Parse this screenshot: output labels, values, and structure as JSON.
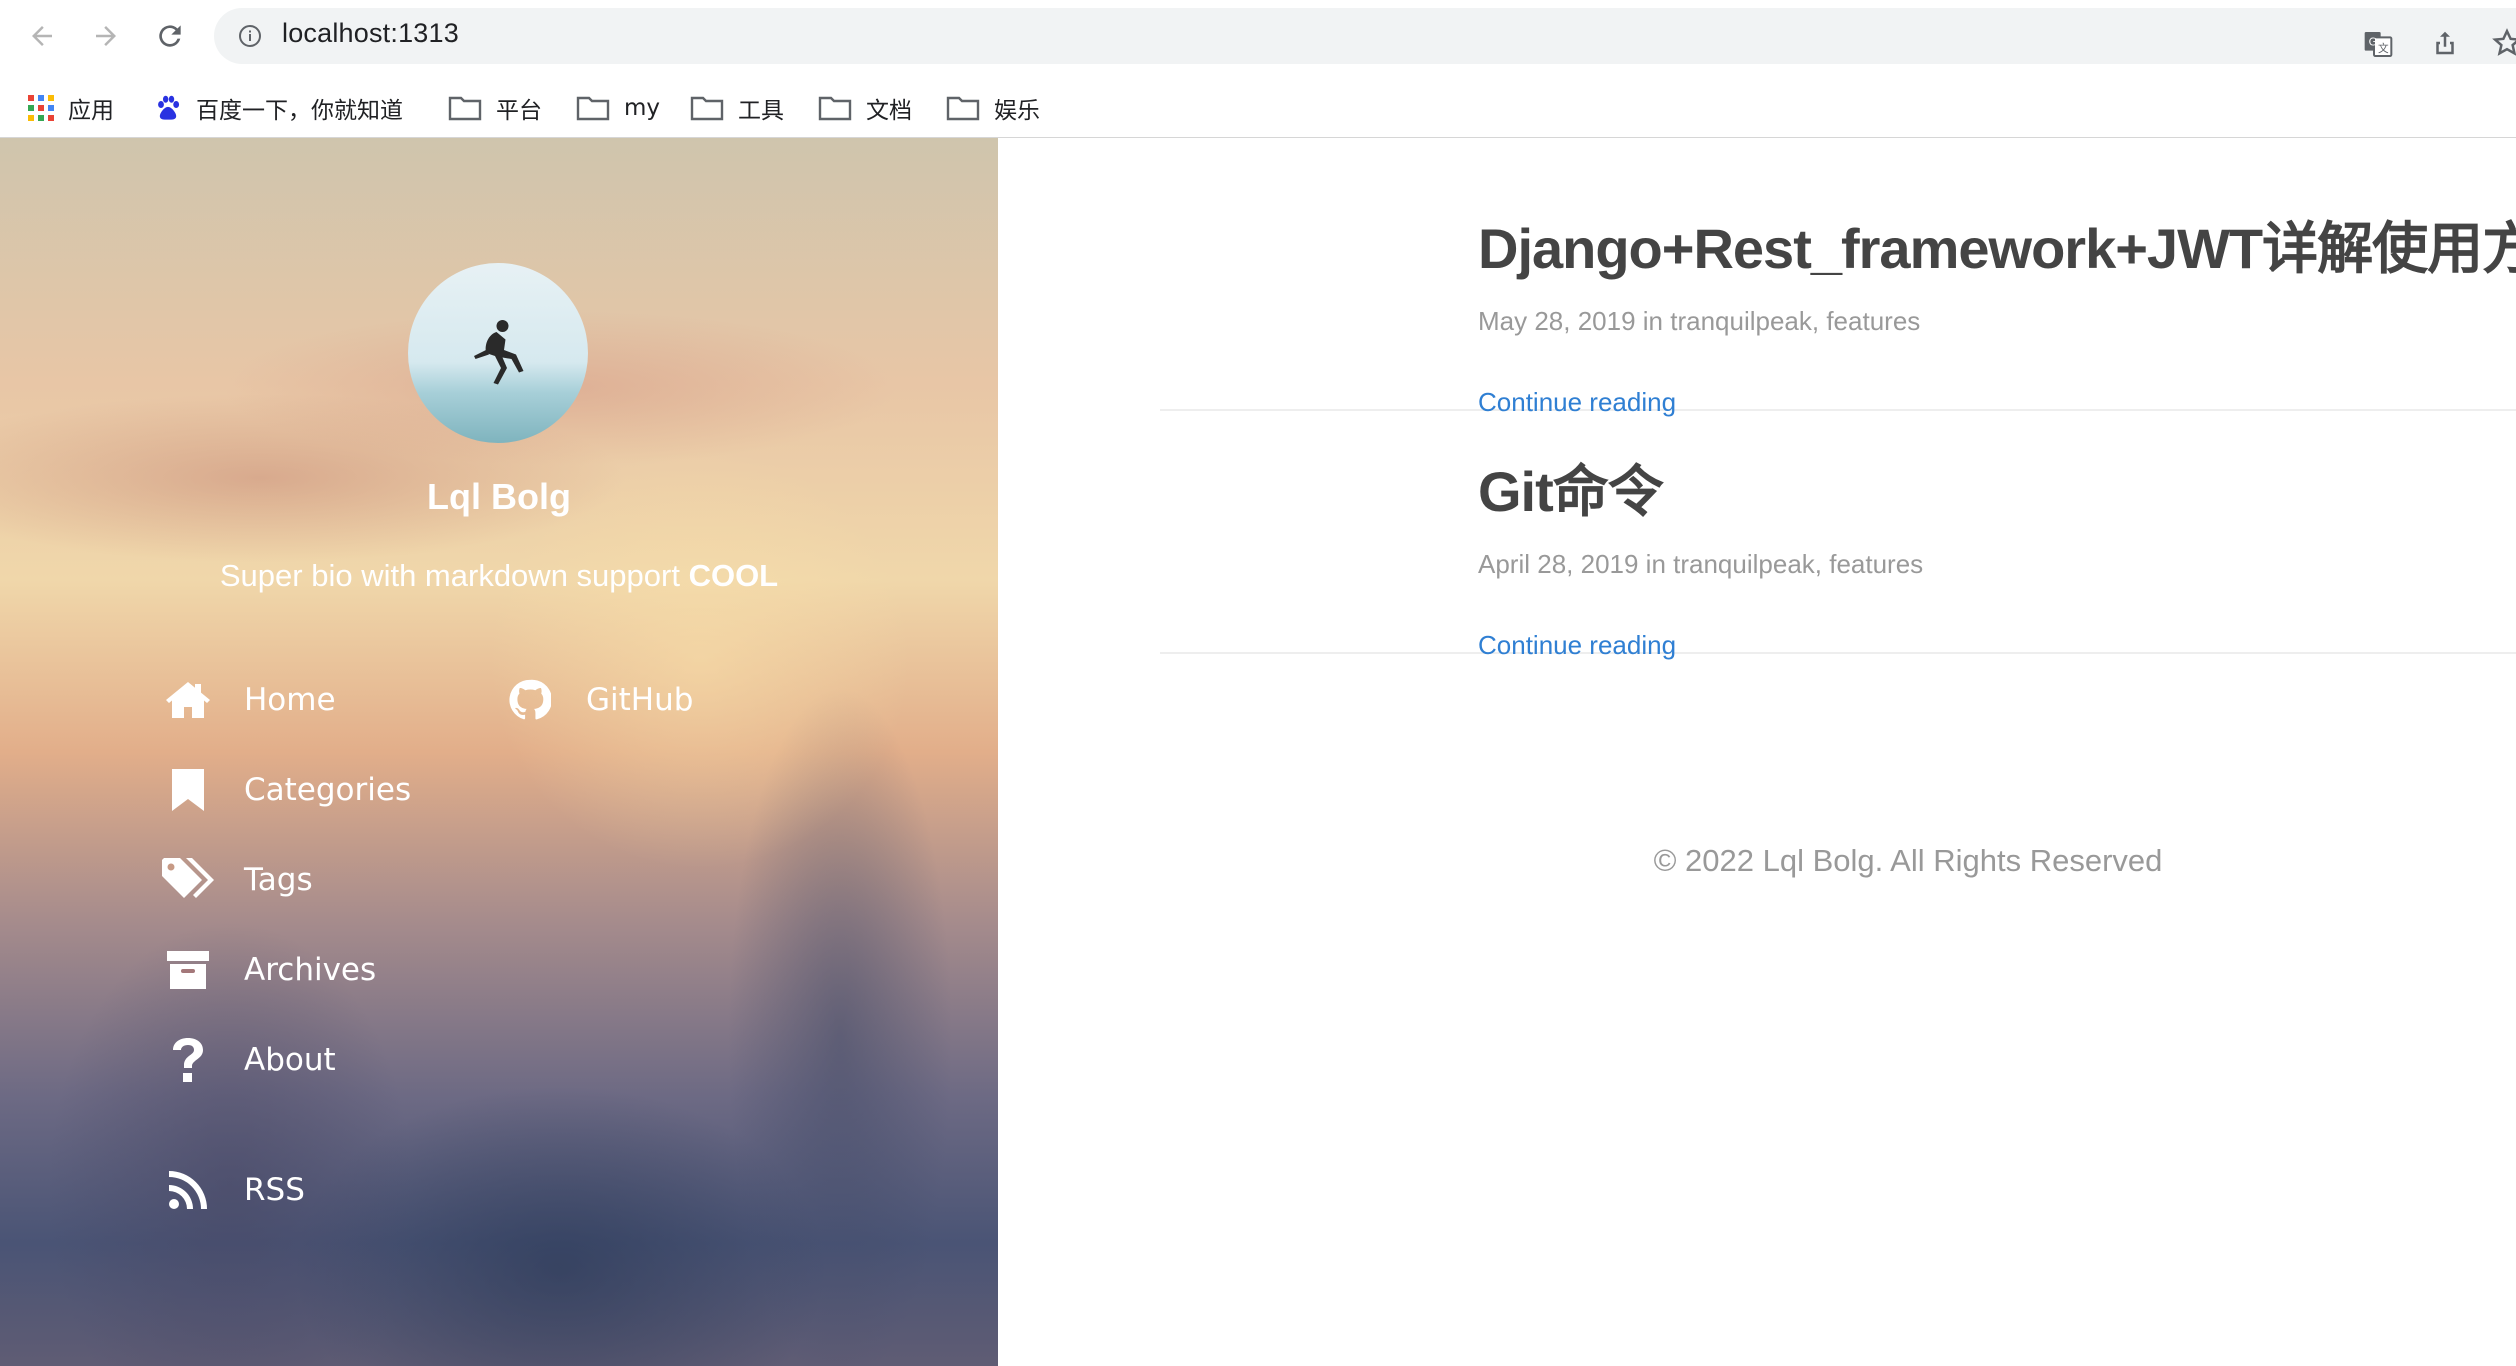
{
  "browser": {
    "url": "localhost:1313",
    "bookmarks": [
      {
        "label": "应用",
        "icon": "apps-grid-icon"
      },
      {
        "label": "百度一下，你就知道",
        "icon": "baidu-paw-icon"
      },
      {
        "label": "平台",
        "icon": "folder-icon"
      },
      {
        "label": "my",
        "icon": "folder-icon"
      },
      {
        "label": "工具",
        "icon": "folder-icon"
      },
      {
        "label": "文档",
        "icon": "folder-icon"
      },
      {
        "label": "娱乐",
        "icon": "folder-icon"
      }
    ]
  },
  "sidebar": {
    "blog_title": "Lql Bolg",
    "bio_text": "Super bio with markdown support ",
    "bio_bold": "COOL",
    "menu": [
      {
        "label": "Home",
        "icon": "home-icon"
      },
      {
        "label": "GitHub",
        "icon": "github-icon"
      },
      {
        "label": "Categories",
        "icon": "bookmark-icon"
      },
      {
        "label": "Tags",
        "icon": "tags-icon"
      },
      {
        "label": "Archives",
        "icon": "archive-icon"
      },
      {
        "label": "About",
        "icon": "question-icon"
      },
      {
        "label": "RSS",
        "icon": "rss-icon"
      }
    ]
  },
  "posts": [
    {
      "title": "Django+Rest_framework+JWT详解使用方法",
      "meta": "May 28, 2019 in tranquilpeak, features",
      "more": "Continue reading"
    },
    {
      "title": "Git命令",
      "meta": "April 28, 2019 in tranquilpeak, features",
      "more": "Continue reading"
    }
  ],
  "footer": "© 2022 Lql Bolg. All Rights Reserved",
  "colors": {
    "link": "#2f7fd3",
    "meta": "#999999",
    "title": "#444444"
  }
}
